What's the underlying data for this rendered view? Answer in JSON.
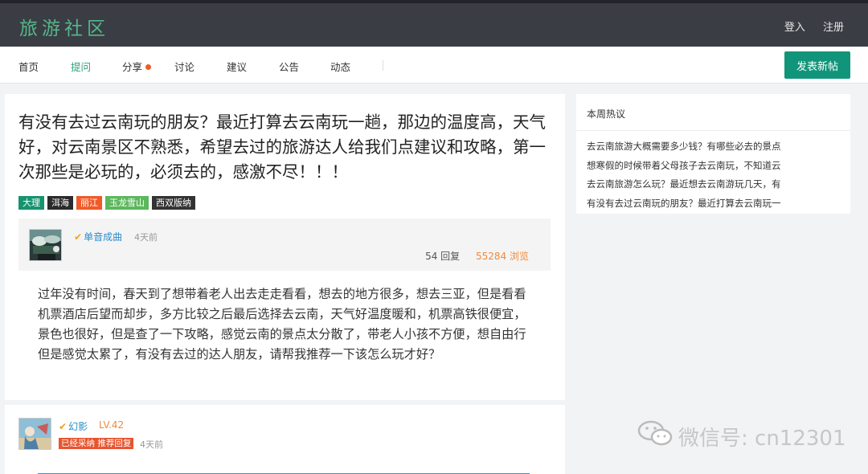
{
  "header": {
    "logo": "旅游社区",
    "login": "登入",
    "register": "注册"
  },
  "nav": {
    "items": [
      "首页",
      "提问",
      "分享",
      "讨论",
      "建议",
      "公告",
      "动态"
    ],
    "active_index": 1,
    "dot_on": "分享",
    "post_button": "发表新帖"
  },
  "question": {
    "title": "有没有去过云南玩的朋友？最近打算去云南玩一趟，那边的温度高，天气好，对云南景区不熟悉，希望去过的旅游达人给我们点建议和攻略，第一次那些是必玩的，必须去的，感激不尽！！！",
    "tags": [
      {
        "label": "大理",
        "color": "#17936f"
      },
      {
        "label": "洱海",
        "color": "#2b2b2b"
      },
      {
        "label": "丽江",
        "color": "#f05a28"
      },
      {
        "label": "玉龙雪山",
        "color": "#5cb85c"
      },
      {
        "label": "西双版纳",
        "color": "#333333"
      }
    ],
    "author": {
      "name": "单音成曲",
      "time": "4天前"
    },
    "replies": "54 回复",
    "views": "55284 浏览",
    "body": "过年没有时间，春天到了想带着老人出去走走看看，想去的地方很多，想去三亚，但是看看机票酒店后望而却步，多方比较之后最后选择去云南，天气好温度暖和，机票高铁很便宜，景色也很好，但是查了一下攻略，感觉云南的景点太分散了，带老人小孩不方便，想自由行但是感觉太累了，有没有去过的达人朋友，请帮我推荐一下该怎么玩才好？"
  },
  "answer": {
    "name": "幻影",
    "level": "LV.42",
    "badge": "已经采纳 推荐回复",
    "time": "4天前"
  },
  "sidebar": {
    "title": "本周热议",
    "items": [
      "去云南旅游大概需要多少钱？有哪些必去的景点",
      "想寒假的时候带着父母孩子去云南玩，不知道云",
      "去云南旅游怎么玩？最近想去云南游玩几天，有",
      "有没有去过云南玩的朋友？最近打算去云南玩一"
    ]
  },
  "watermark": "微信号: cn12301",
  "colors": {
    "brand_green": "#11957a",
    "header_bg": "#3a3d44",
    "link_blue": "#2d8ec9",
    "accent_orange": "#f08a3c"
  }
}
